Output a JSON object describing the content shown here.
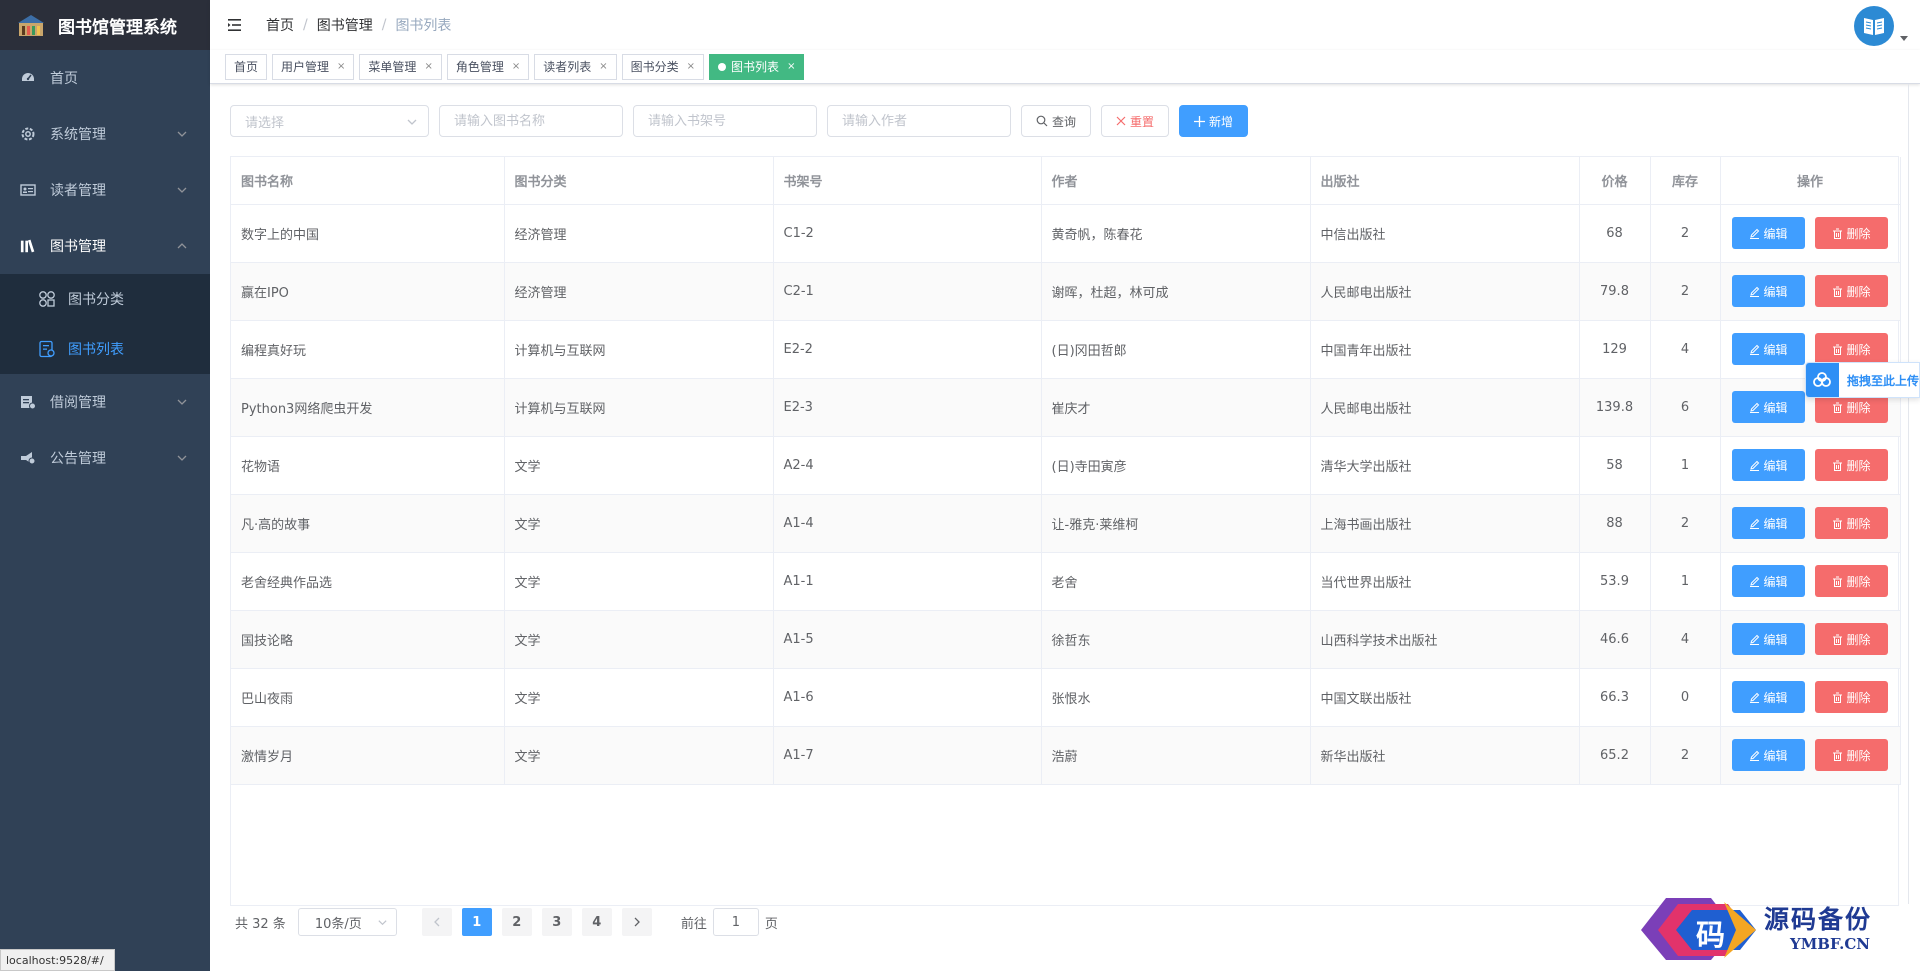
{
  "app": {
    "title": "图书馆管理系统"
  },
  "sidebar": {
    "items": [
      {
        "label": "首页",
        "icon": "dashboard-icon"
      },
      {
        "label": "系统管理",
        "icon": "gear-icon"
      },
      {
        "label": "读者管理",
        "icon": "id-card-icon"
      },
      {
        "label": "图书管理",
        "icon": "books-icon"
      }
    ],
    "book_sub": [
      {
        "label": "图书分类",
        "icon": "category-icon"
      },
      {
        "label": "图书列表",
        "icon": "list-icon"
      }
    ],
    "after": [
      {
        "label": "借阅管理",
        "icon": "borrow-icon"
      },
      {
        "label": "公告管理",
        "icon": "announce-icon"
      }
    ]
  },
  "breadcrumb": [
    "首页",
    "图书管理",
    "图书列表"
  ],
  "tags": [
    {
      "label": "首页"
    },
    {
      "label": "用户管理"
    },
    {
      "label": "菜单管理"
    },
    {
      "label": "角色管理"
    },
    {
      "label": "读者列表"
    },
    {
      "label": "图书分类"
    },
    {
      "label": "图书列表"
    }
  ],
  "filters": {
    "category_placeholder": "请选择",
    "name_placeholder": "请输入图书名称",
    "shelf_placeholder": "请输入书架号",
    "author_placeholder": "请输入作者",
    "search_label": "查询",
    "reset_label": "重置",
    "add_label": "新增"
  },
  "table": {
    "headers": [
      "图书名称",
      "图书分类",
      "书架号",
      "作者",
      "出版社",
      "价格",
      "库存",
      "操作"
    ],
    "edit_label": "编辑",
    "delete_label": "删除",
    "rows": [
      [
        "数字上的中国",
        "经济管理",
        "C1-2",
        "黄奇帆，陈春花",
        "中信出版社",
        "68",
        "2"
      ],
      [
        "赢在IPO",
        "经济管理",
        "C2-1",
        "谢晖，杜超，林可成",
        "人民邮电出版社",
        "79.8",
        "2"
      ],
      [
        "编程真好玩",
        "计算机与互联网",
        "E2-2",
        "(日)冈田哲郎",
        "中国青年出版社",
        "129",
        "4"
      ],
      [
        "Python3网络爬虫开发",
        "计算机与互联网",
        "E2-3",
        "崔庆才",
        "人民邮电出版社",
        "139.8",
        "6"
      ],
      [
        "花物语",
        "文学",
        "A2-4",
        "(日)寺田寅彦",
        "清华大学出版社",
        "58",
        "1"
      ],
      [
        "凡·高的故事",
        "文学",
        "A1-4",
        "让-雅克·莱维柯",
        "上海书画出版社",
        "88",
        "2"
      ],
      [
        "老舍经典作品选",
        "文学",
        "A1-1",
        "老舍",
        "当代世界出版社",
        "53.9",
        "1"
      ],
      [
        "国技论略",
        "文学",
        "A1-5",
        "徐哲东",
        "山西科学技术出版社",
        "46.6",
        "4"
      ],
      [
        "巴山夜雨",
        "文学",
        "A1-6",
        "张恨水",
        "中国文联出版社",
        "66.3",
        "0"
      ],
      [
        "激情岁月",
        "文学",
        "A1-7",
        "浩蔚",
        "新华出版社",
        "65.2",
        "2"
      ]
    ]
  },
  "pagination": {
    "total_text": "共 32 条",
    "page_size": "10条/页",
    "pages": [
      "1",
      "2",
      "3",
      "4"
    ],
    "goto_prefix": "前往",
    "goto_value": "1",
    "goto_suffix": "页"
  },
  "upload_widget": {
    "label": "拖拽至此上传"
  },
  "status_bar": {
    "url": "localhost:9528/#/"
  },
  "watermark": {
    "main": "源码备份",
    "sub": "YMBF.CN",
    "char": "码"
  },
  "colors": {
    "sidebar": "#304156",
    "primary": "#409eff",
    "danger": "#f56c6c",
    "tag_active": "#42b983"
  }
}
